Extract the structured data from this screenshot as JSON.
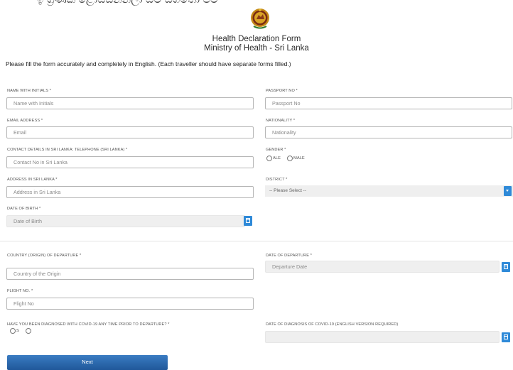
{
  "header": {
    "top_cut_text": "ඉ ග්‍රණ්ක ළොයස්නන්ලා ඔම ස්ගතෝ පම",
    "title": "Health Declaration Form",
    "subtitle": "Ministry of Health - Sri Lanka",
    "instructions": "Please fill the form accurately and completely in English. (Each traveller should have separate forms filled.)"
  },
  "fields": {
    "name_label": "NAME WITH INITIALS *",
    "name_placeholder": "Name with Initials",
    "passport_label": "PASSPORT NO *",
    "passport_placeholder": "Passport No",
    "email_label": "EMAIL ADDRESS *",
    "email_placeholder": "Email",
    "nationality_label": "NATIONALITY *",
    "nationality_placeholder": "Nationality",
    "contact_label": "CONTACT DETAILS IN SRI LANKA: TELEPHONE (SRI LANKA) *",
    "contact_placeholder": "Contact No in Sri Lanka",
    "gender_label": "GENDER *",
    "gender_opt1": "ALE",
    "gender_opt2": "MALE",
    "address_label": "ADDRESS IN SRI LANKA *",
    "address_placeholder": "Address in Sri Lanka",
    "district_label": "DISTRICT *",
    "district_value": "-- Please Select --",
    "dob_label": "DATE OF BIRTH *",
    "dob_placeholder": "Date of Birth",
    "country_label": "COUNTRY (ORIGIN) OF DEPARTURE *",
    "country_placeholder": "Country of the Origin",
    "departure_label": "DATE OF DEPARTURE *",
    "departure_placeholder": "Departure Date",
    "flight_label": "FLIGHT NO. *",
    "flight_placeholder": "Flight No",
    "covid_label": "HAVE YOU BEEN DIAGNOSED WITH COVID-19 ANY TIME PRIOR TO DEPARTURE? *",
    "covid_opt1": "S",
    "covid_opt2": "",
    "diag_label": "DATE OF DIAGNOSIS OF COVID-19 (ENGLISH VERSION REQUIRED)",
    "diag_placeholder": ""
  },
  "actions": {
    "next_label": "Next"
  },
  "colors": {
    "accent": "#2f8ad8",
    "button": "#2a6ab0"
  }
}
